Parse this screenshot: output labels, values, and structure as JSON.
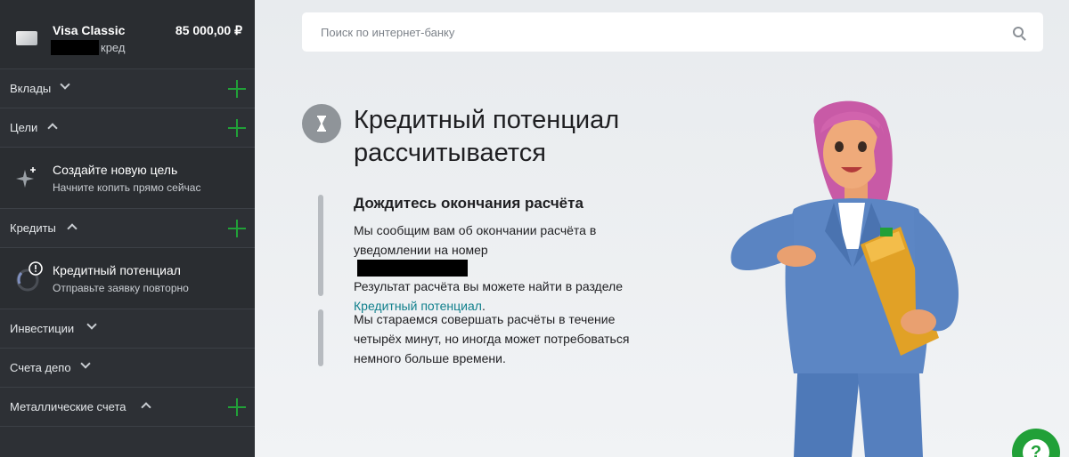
{
  "card": {
    "name": "Visa Classic",
    "amount": "85 000,00 ₽",
    "sub": "кред"
  },
  "sidebar": {
    "sections": [
      {
        "label": "Вклады",
        "expanded": false,
        "add": true
      },
      {
        "label": "Цели",
        "expanded": true,
        "add": true
      },
      {
        "label": "Кредиты",
        "expanded": true,
        "add": true
      },
      {
        "label": "Инвестиции",
        "expanded": false,
        "add": false
      },
      {
        "label": "Счета депо",
        "expanded": false,
        "add": false
      },
      {
        "label": "Металлические счета",
        "expanded": true,
        "add": true
      }
    ],
    "goal": {
      "title": "Создайте новую цель",
      "sub": "Начните копить прямо сейчас"
    },
    "credit": {
      "title": "Кредитный потенциал",
      "sub": "Отправьте заявку повторно"
    }
  },
  "search": {
    "placeholder": "Поиск по интернет-банку"
  },
  "main": {
    "heading_line1": "Кредитный потенциал",
    "heading_line2": "рассчитывается",
    "subheading": "Дождитесь окончания расчёта",
    "p1_line1": "Мы сообщим вам об окончании расчёта в",
    "p1_line2": "уведомлении на номер",
    "p1_line3": "Результат расчёта вы можете найти в разделе",
    "p1_link": "Кредитный потенциал",
    "p1_end": ".",
    "p2_line1": "Мы стараемся совершать расчёты в течение",
    "p2_line2": "четырёх минут, но иногда может потребоваться",
    "p2_line3": "немного больше времени."
  },
  "help": {
    "label": "?"
  },
  "colors": {
    "accent": "#21a038",
    "link": "#107f8c",
    "sidebar": "#2d3035"
  }
}
